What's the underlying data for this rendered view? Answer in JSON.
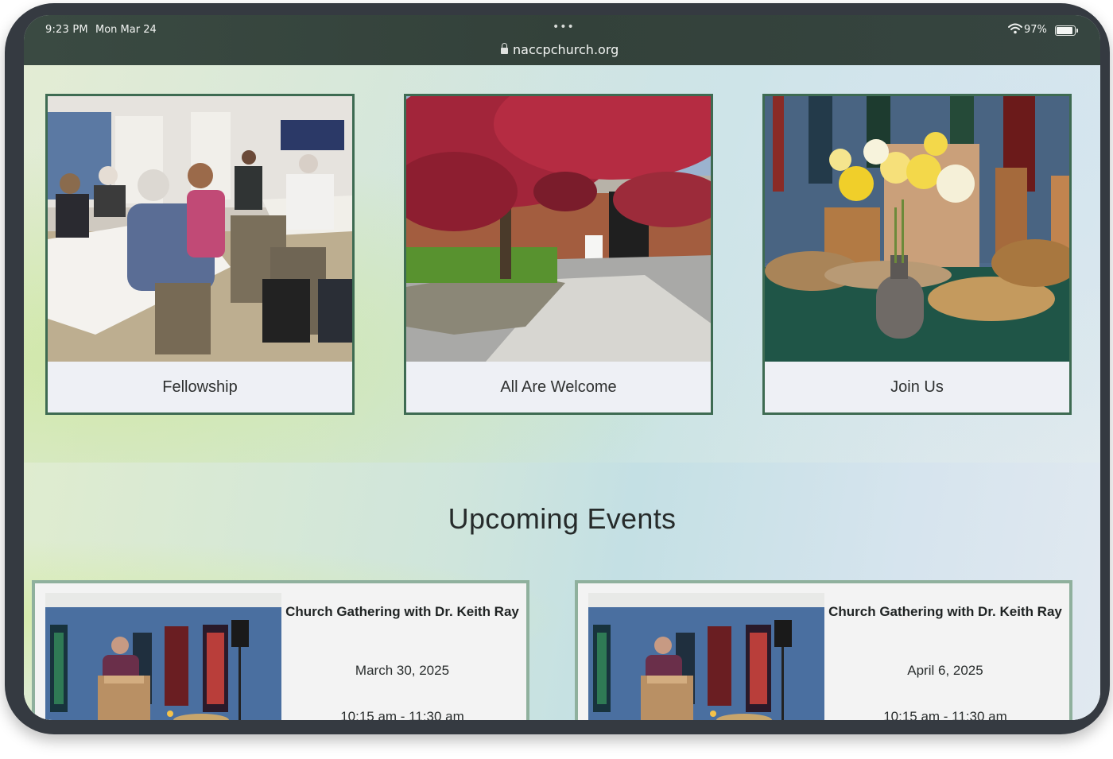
{
  "status_bar": {
    "time": "9:23 PM",
    "date": "Mon Mar 24",
    "battery": "97%",
    "battery_level": 0.97
  },
  "browser": {
    "tab_dots": "•••",
    "url": "naccpchurch.org"
  },
  "cards": [
    {
      "label": "Fellowship"
    },
    {
      "label": "All Are Welcome"
    },
    {
      "label": "Join Us"
    }
  ],
  "events_section": {
    "heading": "Upcoming Events",
    "events": [
      {
        "title": "Church Gathering with Dr. Keith Ray",
        "date": "March 30, 2025",
        "time": "10:15 am - 11:30 am"
      },
      {
        "title": "Church Gathering with Dr. Keith Ray",
        "date": "April 6, 2025",
        "time": "10:15 am - 11:30 am"
      }
    ]
  },
  "colors": {
    "card_border": "#3e6b52",
    "event_border": "#8fb09d",
    "device_frame": "#353a41",
    "status_bar": "#36443d"
  }
}
